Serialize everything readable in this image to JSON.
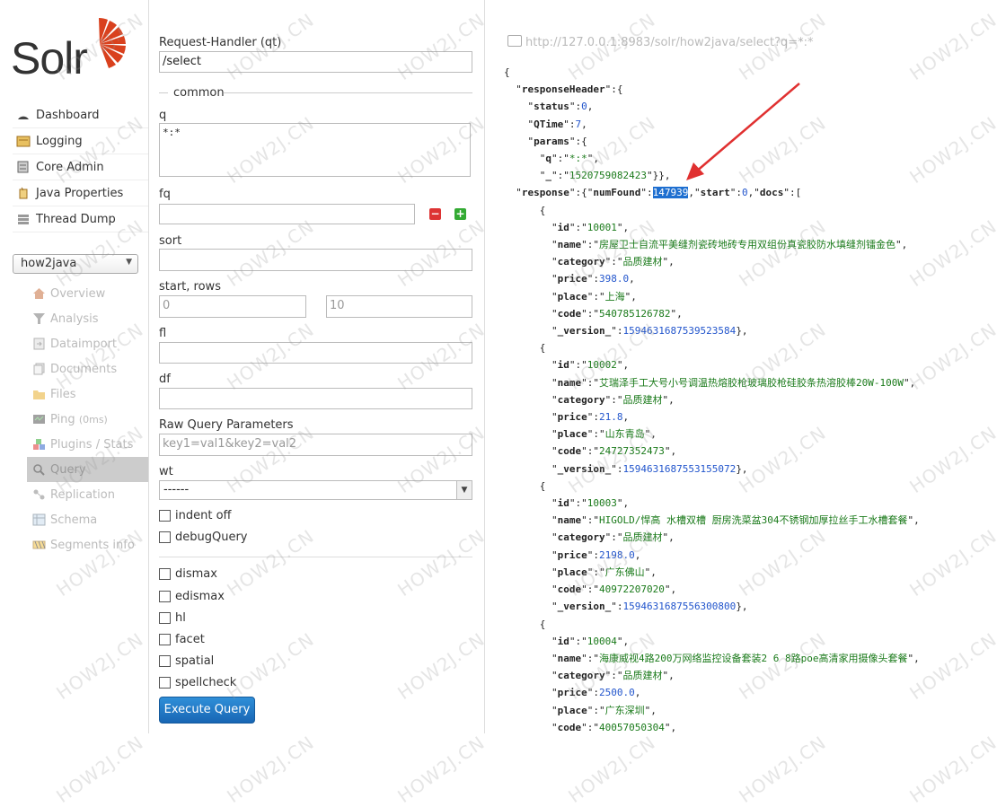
{
  "logo": {
    "text": "Solr"
  },
  "main_menu": [
    {
      "label": "Dashboard",
      "icon": "dashboard-icon"
    },
    {
      "label": "Logging",
      "icon": "logging-icon"
    },
    {
      "label": "Core Admin",
      "icon": "core-admin-icon"
    },
    {
      "label": "Java Properties",
      "icon": "java-properties-icon"
    },
    {
      "label": "Thread Dump",
      "icon": "thread-dump-icon"
    }
  ],
  "core_selector": {
    "value": "how2java"
  },
  "core_menu": [
    {
      "label": "Overview"
    },
    {
      "label": "Analysis"
    },
    {
      "label": "Dataimport"
    },
    {
      "label": "Documents"
    },
    {
      "label": "Files"
    },
    {
      "label": "Ping",
      "extra": "(0ms)"
    },
    {
      "label": "Plugins / Stats"
    },
    {
      "label": "Query",
      "active": true
    },
    {
      "label": "Replication"
    },
    {
      "label": "Schema"
    },
    {
      "label": "Segments info"
    }
  ],
  "form": {
    "request_handler_label": "Request-Handler (qt)",
    "request_handler_value": "/select",
    "common_legend": "common",
    "q_label": "q",
    "q_value": "*:*",
    "fq_label": "fq",
    "fq_value": "",
    "sort_label": "sort",
    "sort_value": "",
    "start_rows_label": "start, rows",
    "start_placeholder": "0",
    "rows_placeholder": "10",
    "fl_label": "fl",
    "df_label": "df",
    "raw_label": "Raw Query Parameters",
    "raw_placeholder": "key1=val1&key2=val2",
    "wt_label": "wt",
    "wt_value": "------",
    "indent_off": "indent off",
    "debug_query": "debugQuery",
    "dismax": "dismax",
    "edismax": "edismax",
    "hl": "hl",
    "facet": "facet",
    "spatial": "spatial",
    "spellcheck": "spellcheck",
    "execute_label": "Execute Query"
  },
  "response": {
    "url": "http://127.0.0.1:8983/solr/how2java/select?q=*:*",
    "status": "0",
    "qtime": "7",
    "q": "*:*",
    "underscore": "1520759082423",
    "numFound": "147939",
    "start": "0",
    "docs": [
      {
        "id": "10001",
        "name": "房屋卫士自流平美缝剂瓷砖地砖专用双组份真瓷胶防水填缝剂镭金色",
        "category": "品质建材",
        "price": "398.0",
        "place": "上海",
        "code": "540785126782",
        "version": "1594631687539523584"
      },
      {
        "id": "10002",
        "name": "艾瑞泽手工大号小号调温热熔胶枪玻璃胶枪硅胶条热溶胶棒20W-100W",
        "category": "品质建材",
        "price": "21.8",
        "place": "山东青岛",
        "code": "24727352473",
        "version": "1594631687553155072"
      },
      {
        "id": "10003",
        "name": "HIGOLD/悍高 水槽双槽 厨房洗菜盆304不锈钢加厚拉丝手工水槽套餐",
        "category": "品质建材",
        "price": "2198.0",
        "place": "广东佛山",
        "code": "40972207020",
        "version": "1594631687556300800"
      },
      {
        "id": "10004",
        "name": "海康威视4路200万网络监控设备套装2 6 8路poe高清家用摄像头套餐",
        "category": "品质建材",
        "price": "2500.0",
        "place": "广东深圳",
        "code": "40057050304"
      }
    ]
  },
  "watermark": "HOW2J.CN",
  "colors": {
    "highlight": "#1e6fd0",
    "string": "#1a7a1a",
    "number": "#2255cc",
    "arrow": "#e03030",
    "button": "#1f74c4"
  }
}
